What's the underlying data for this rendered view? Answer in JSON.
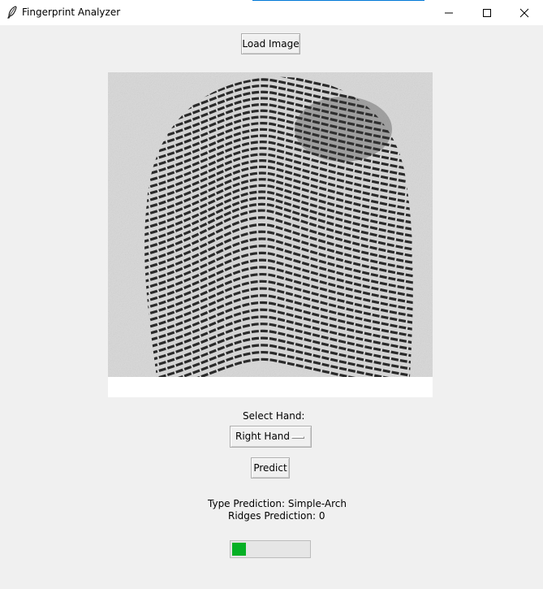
{
  "window": {
    "title": "Fingerprint Analyzer",
    "icon": "feather-icon"
  },
  "controls": {
    "load_label": "Load Image",
    "hand_label": "Select Hand:",
    "hand_selected": "Right Hand",
    "predict_label": "Predict"
  },
  "results": {
    "type_prediction": "Type Prediction: Simple-Arch",
    "ridges_prediction": "Ridges Prediction: 0"
  },
  "progress": {
    "value_fraction": 0.18,
    "color": "#06b025"
  },
  "colors": {
    "background": "#f0f0f0",
    "titlebar": "#ffffff",
    "accent": "#0078d7"
  }
}
